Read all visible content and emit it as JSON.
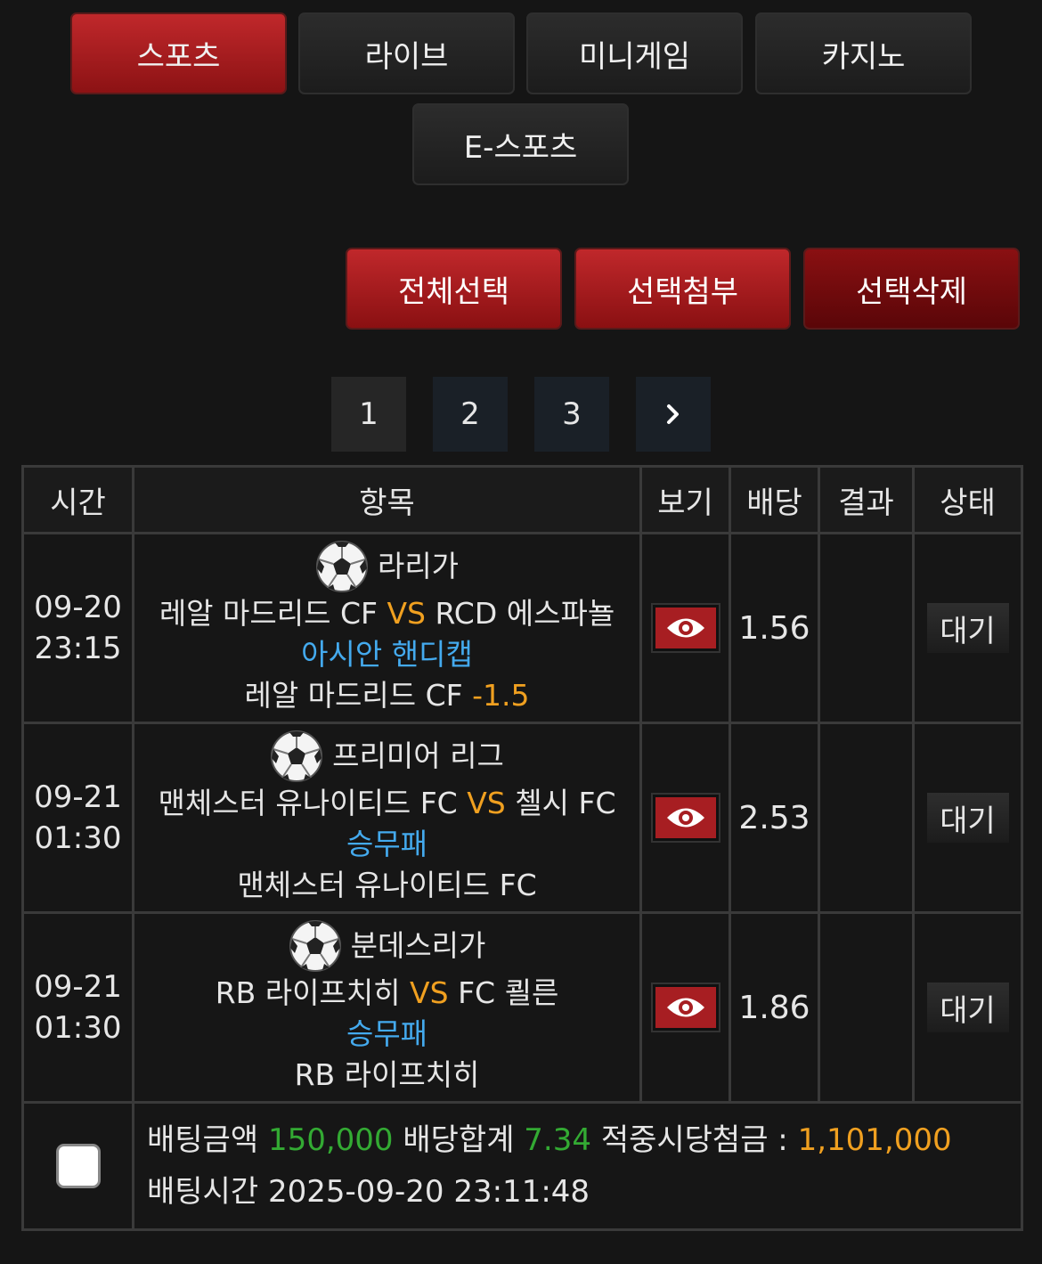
{
  "nav_tabs": [
    {
      "label": "스포츠",
      "active": true
    },
    {
      "label": "라이브",
      "active": false
    },
    {
      "label": "미니게임",
      "active": false
    },
    {
      "label": "카지노",
      "active": false
    },
    {
      "label": "E-스포츠",
      "active": false
    }
  ],
  "actions": {
    "select_all": "전체선택",
    "attach_selected": "선택첨부",
    "delete_selected": "선택삭제"
  },
  "pagination": {
    "pages": [
      "1",
      "2",
      "3"
    ],
    "current": "1",
    "next_icon": "chevron-right"
  },
  "table": {
    "headers": {
      "time": "시간",
      "item": "항목",
      "view": "보기",
      "odds": "배당",
      "result": "결과",
      "status": "상태"
    },
    "rows": [
      {
        "date": "09-20",
        "time": "23:15",
        "league": "라리가",
        "home": "레알 마드리드 CF",
        "vs": "VS",
        "away": "RCD 에스파뇰",
        "market": "아시안 핸디캡",
        "pick": "레알 마드리드 CF",
        "handicap": "-1.5",
        "odds": "1.56",
        "result": "",
        "status": "대기"
      },
      {
        "date": "09-21",
        "time": "01:30",
        "league": "프리미어 리그",
        "home": "맨체스터 유나이티드 FC",
        "vs": "VS",
        "away": "첼시 FC",
        "market": "승무패",
        "pick": "맨체스터 유나이티드 FC",
        "handicap": "",
        "odds": "2.53",
        "result": "",
        "status": "대기"
      },
      {
        "date": "09-21",
        "time": "01:30",
        "league": "분데스리가",
        "home": "RB 라이프치히",
        "vs": "VS",
        "away": "FC 쾰른",
        "market": "승무패",
        "pick": "RB 라이프치히",
        "handicap": "",
        "odds": "1.86",
        "result": "",
        "status": "대기"
      }
    ]
  },
  "summary": {
    "bet_amount_label": "배팅금액",
    "bet_amount": "150,000",
    "total_odds_label": "배당합계",
    "total_odds": "7.34",
    "payout_label": "적중시당첨금 :",
    "payout": "1,101,000",
    "bet_time_label": "배팅시간",
    "bet_time": "2025-09-20 23:11:48"
  },
  "colors": {
    "accent_red": "#c0282b",
    "odds_green": "#33aa33",
    "vs_orange": "#f0a020",
    "market_blue": "#44aaee"
  },
  "icons": {
    "sport": "soccer-ball-icon",
    "view": "eye-icon"
  }
}
